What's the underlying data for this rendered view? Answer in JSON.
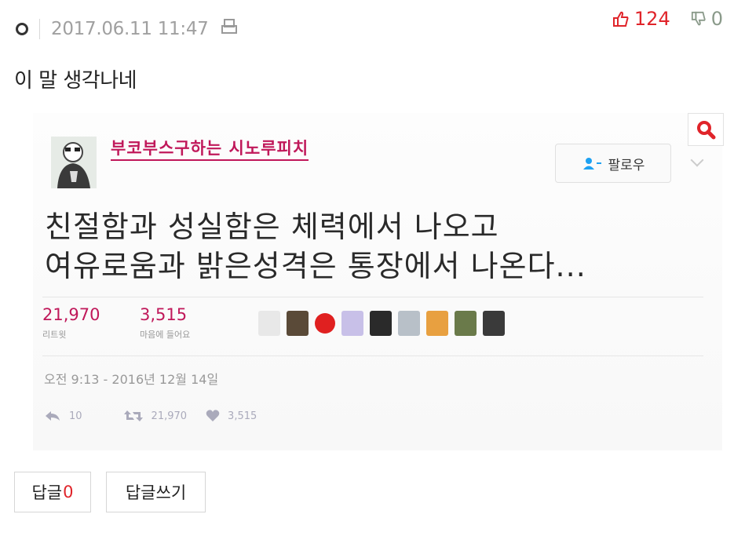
{
  "post": {
    "date": "2017.06.11 11:47",
    "upvotes": "124",
    "downvotes": "0",
    "body": "이 말 생각나네"
  },
  "tweet": {
    "username": "부코부스구하는 시노루피치",
    "follow_label": "팔로우",
    "text_line1": "친절함과 성실함은 체력에서 나오고",
    "text_line2": "여유로움과 밝은성격은 통장에서 나온다...",
    "retweets": "21,970",
    "retweets_label": "리트윗",
    "likes": "3,515",
    "likes_label": "마음에 들어요",
    "timestamp": "오전 9:13 - 2016년 12월 14일",
    "reply_count": "10",
    "retweet_count": "21,970",
    "like_count": "3,515",
    "liker_colors": [
      "#e8e8e8",
      "#5a4a38",
      "#e02020",
      "#c8c0e8",
      "#2a2a2a",
      "#b8c0c8",
      "#e8a040",
      "#6a7a4a",
      "#3a3a3a"
    ]
  },
  "buttons": {
    "reply_label": "답글",
    "reply_count": "0",
    "write_label": "답글쓰기"
  },
  "colors": {
    "accent_red": "#e0242a",
    "tweet_pink": "#c0185a"
  }
}
